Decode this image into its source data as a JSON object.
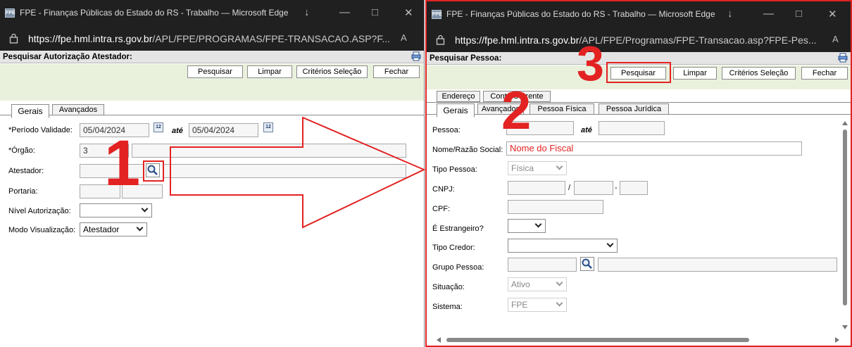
{
  "left": {
    "title": "FPE - Finanças Públicas do Estado do RS - Trabalho — Microsoft Edge",
    "url_host": "https://fpe.hml.intra.rs.gov.br",
    "url_path": "/APL/FPE/PROGRAMAS/FPE-TRANSACAO.ASP?F...",
    "header": "Pesquisar Autorização Atestador:",
    "buttons": [
      "Pesquisar",
      "Limpar",
      "Critérios Seleção",
      "Fechar"
    ],
    "tabs": [
      "Gerais",
      "Avançados"
    ],
    "fields": {
      "periodo_label": "*Período Validade:",
      "periodo_from": "05/04/2024",
      "ate": "até",
      "periodo_to": "05/04/2024",
      "orgao_label": "*Órgão:",
      "orgao_value": "3",
      "atestador_label": "Atestador:",
      "portaria_label": "Portaria:",
      "nivel_label": "Nível Autorização:",
      "modo_label": "Modo Visualização:",
      "modo_value": "Atestador"
    },
    "calendar_glyph": "12"
  },
  "right": {
    "title": "FPE - Finanças Públicas do Estado do RS - Trabalho — Microsoft Edge",
    "url_host": "https://fpe.hml.intra.rs.gov.br",
    "url_path": "/APL/FPE/Programas/FPE-Transacao.asp?FPE-Pes...",
    "header": "Pesquisar Pessoa:",
    "buttons": [
      "Pesquisar",
      "Limpar",
      "Critérios Seleção",
      "Fechar"
    ],
    "tabs_row1": [
      "Endereço",
      "Conta Corrente"
    ],
    "tabs_row2": [
      "Gerais",
      "Avançados",
      "Pessoa Física",
      "Pessoa Jurídica"
    ],
    "fields": {
      "pessoa_label": "Pessoa:",
      "ate": "até",
      "nome_label": "Nome/Razão Social:",
      "nome_value": "Nome do Fiscal",
      "tipo_label": "Tipo Pessoa:",
      "tipo_value": "Física",
      "cnpj_label": "CNPJ:",
      "cnpj_sep1": "/",
      "cnpj_sep2": "-",
      "cpf_label": "CPF:",
      "estrangeiro_label": "É Estrangeiro?",
      "credor_label": "Tipo Credor:",
      "grupo_label": "Grupo Pessoa:",
      "situacao_label": "Situação:",
      "situacao_value": "Ativo",
      "sistema_label": "Sistema:",
      "sistema_value": "FPE"
    }
  },
  "annotations": {
    "step1": "1",
    "step2": "2",
    "step3": "3",
    "accent_color": "#e32222"
  },
  "window_controls": [
    "↓",
    "—",
    "□",
    "✕"
  ],
  "reader_glyph": "A"
}
